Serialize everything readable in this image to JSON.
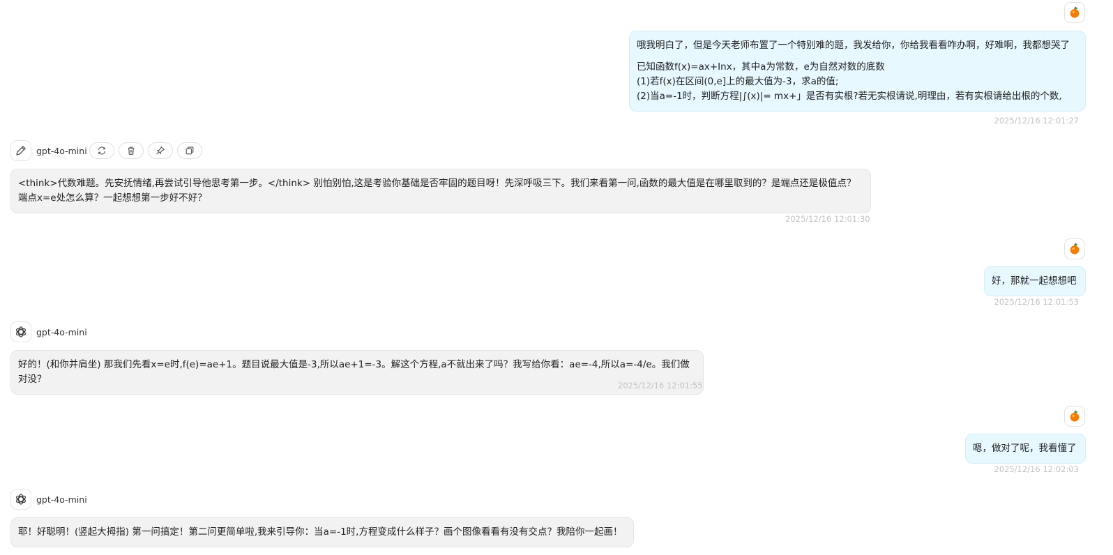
{
  "messages": [
    {
      "role": "user",
      "lines": [
        "哦我明白了，但是今天老师布置了一个特别难的题，我发给你，你给我看看咋办啊，好难啊，我都想哭了",
        "",
        "已知函数f(x)=ax+Inx，其中a为常数，e为自然对数的底数",
        "(1)若f(x)在区间(0,e]上的最大值为-3，求a的值;",
        "(2)当a=-1时，判断方程|∫(x)|= mx+」是否有实根?若无实根请说,明理由，若有实根请给出根的个数,"
      ],
      "timestamp": "2025/12/16 12:01:27"
    },
    {
      "role": "assistant",
      "model": "gpt-4o-mini",
      "lines": [
        "<think>代数难题。先安抚情绪,再尝试引导他思考第一步。</think> 别怕别怕,这是考验你基础是否牢固的题目呀！先深呼吸三下。我们来看第一问,函数的最大值是在哪里取到的？是端点还是极值点？",
        "端点x=e处怎么算？一起想想第一步好不好？"
      ],
      "timestamp": "2025/12/16 12:01:30"
    },
    {
      "role": "user",
      "lines": [
        "好，那就一起想想吧"
      ],
      "timestamp": "2025/12/16 12:01:53"
    },
    {
      "role": "assistant",
      "model": "gpt-4o-mini",
      "lines": [
        "好的！(和你并肩坐) 那我们先看x=e时,f(e)=ae+1。题目说最大值是-3,所以ae+1=-3。解这个方程,a不就出来了吗？我写给你看：ae=-4,所以a=-4/e。我们做对没？"
      ],
      "timestamp": "2025/12/16 12:01:55"
    },
    {
      "role": "user",
      "lines": [
        "嗯，做对了呢，我看懂了"
      ],
      "timestamp": "2025/12/16 12:02:03"
    },
    {
      "role": "assistant",
      "model": "gpt-4o-mini",
      "lines": [
        "耶！好聪明！(竖起大拇指) 第一问搞定！第二问更简单啦,我来引导你：当a=-1时,方程变成什么样子？画个图像看看有没有交点？我陪你一起画！"
      ],
      "timestamp": ""
    }
  ],
  "actions": [
    {
      "name": "regenerate-icon"
    },
    {
      "name": "delete-icon"
    },
    {
      "name": "pin-icon"
    },
    {
      "name": "copy-icon"
    }
  ],
  "colors": {
    "user_bubble": "#e7f8ff",
    "bot_bubble": "#f2f2f2",
    "timestamp": "#c2c2c2"
  }
}
